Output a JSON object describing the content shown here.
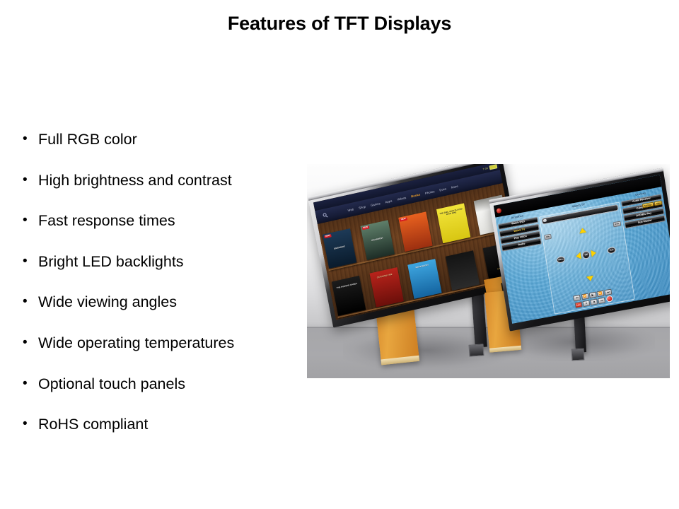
{
  "slide": {
    "title": "Features of TFT Displays",
    "background_color": "#ffffff",
    "title_color": "#000000"
  },
  "bullets": {
    "marker": "•",
    "items": [
      {
        "label": "Full RGB color"
      },
      {
        "label": "High brightness and contrast"
      },
      {
        "label": "Fast response times"
      },
      {
        "label": "Bright LED backlights"
      },
      {
        "label": "Wide viewing angles"
      },
      {
        "label": "Wide operating temperatures"
      },
      {
        "label": "Optional touch panels"
      },
      {
        "label": "RoHS compliant"
      }
    ]
  },
  "product_photo": {
    "caption": "Two TFT LCD display panels with flex PCB ribbon cables on a gray studio backdrop",
    "background_top_color": "#fdfdfd",
    "background_bottom_color": "#a8a8ab",
    "ribbon_color": "#d8882a",
    "left_display": {
      "name": "tablet-bookshelf-display",
      "status_bar": {
        "clock": "7:08"
      },
      "search_icon": "search-icon",
      "nav_items": [
        {
          "label": "Web",
          "active": false
        },
        {
          "label": "Shop",
          "active": false
        },
        {
          "label": "Games",
          "active": false
        },
        {
          "label": "Apps",
          "active": false
        },
        {
          "label": "Videos",
          "active": false
        },
        {
          "label": "Books",
          "active": true
        },
        {
          "label": "Photos",
          "active": false
        },
        {
          "label": "Docs",
          "active": false
        },
        {
          "label": "More",
          "active": false
        }
      ],
      "shelf_rows": [
        {
          "books": [
            {
              "title": "DIVERGENT",
              "badge": "NEW",
              "color_top": "#1d3a57",
              "color_bottom": "#0a1b2c",
              "accent": "#e0a43c"
            },
            {
              "title": "INSURGENT",
              "badge": "NEW",
              "color_top": "#5f7f6a",
              "color_bottom": "#1d2d26",
              "accent": "#cfe0c8"
            },
            {
              "title": "",
              "badge": "NEW",
              "color_top": "#e8611f",
              "color_bottom": "#9c2f10",
              "accent": "#58c6e8"
            },
            {
              "title": "THE GIRL WHO PLAYED WITH FIRE",
              "badge": "",
              "color_top": "#f2e43a",
              "color_bottom": "#d8c612",
              "accent": "#2a2a2a"
            },
            {
              "title": "",
              "badge": "",
              "color_top": "#f6f6f4",
              "color_bottom": "#d8d8d4",
              "accent": "#4a4a4a"
            }
          ]
        },
        {
          "books": [
            {
              "title": "THE HUNGER GAMES",
              "badge": "",
              "color_top": "#1c1c1c",
              "color_bottom": "#000000",
              "accent": "#d8b24a"
            },
            {
              "title": "CATCHING FIRE",
              "badge": "",
              "color_top": "#b8231b",
              "color_bottom": "#6b0f0a",
              "accent": "#f2c83c"
            },
            {
              "title": "MOCKINGJAY",
              "badge": "",
              "color_top": "#3ea6e0",
              "color_bottom": "#1464a0",
              "accent": "#ffffff"
            },
            {
              "title": "",
              "badge": "",
              "color_top": "#141414",
              "color_bottom": "#2b2b2b",
              "accent": "#c8c8c8"
            },
            {
              "title": "LEGEND",
              "badge": "",
              "color_top": "#1a1a1a",
              "color_bottom": "#000000",
              "accent": "#c8a03c"
            }
          ]
        }
      ]
    },
    "right_display": {
      "name": "universal-remote-display",
      "power_button": "power-icon",
      "activities": {
        "title": "Activities",
        "items": [
          {
            "label": "Watch DVD",
            "active": false
          },
          {
            "label": "Watch TV",
            "active": true
          },
          {
            "label": "Play XBOX",
            "active": false
          },
          {
            "label": "Radio",
            "active": false
          }
        ]
      },
      "center": {
        "title": "Watch TV",
        "slider_label": "Volume",
        "buttons": {
          "info": "Info",
          "dvr": "DVR",
          "menu": "Menu",
          "exit": "Exit",
          "ok": "OK",
          "live": "Live"
        },
        "dpad": {
          "up": "up-arrow-icon",
          "down": "down-arrow-icon",
          "left": "left-arrow-icon",
          "right": "right-arrow-icon"
        },
        "transport": [
          {
            "icon": "skip-back-icon",
            "glyph": "⏮"
          },
          {
            "icon": "rewind-icon",
            "glyph": "⏪"
          },
          {
            "icon": "play-icon",
            "glyph": "▶"
          },
          {
            "icon": "fast-forward-icon",
            "glyph": "⏩"
          },
          {
            "icon": "skip-forward-icon",
            "glyph": "⏭"
          },
          {
            "icon": "pause-icon",
            "glyph": "⏸"
          },
          {
            "icon": "stop-icon",
            "glyph": "⏹"
          },
          {
            "icon": "next-track-icon",
            "glyph": "⏭"
          },
          {
            "icon": "record-icon",
            "glyph": ""
          }
        ]
      },
      "devices": {
        "title": "Devices",
        "items": [
          {
            "label": "Audio Receiver"
          },
          {
            "label": "Cable PVR"
          },
          {
            "label": "DVD/Blu Ray"
          },
          {
            "label": "Sub Woofer"
          }
        ]
      },
      "corner_buttons": [
        {
          "label": "Settings"
        },
        {
          "label": "Help"
        }
      ]
    }
  }
}
